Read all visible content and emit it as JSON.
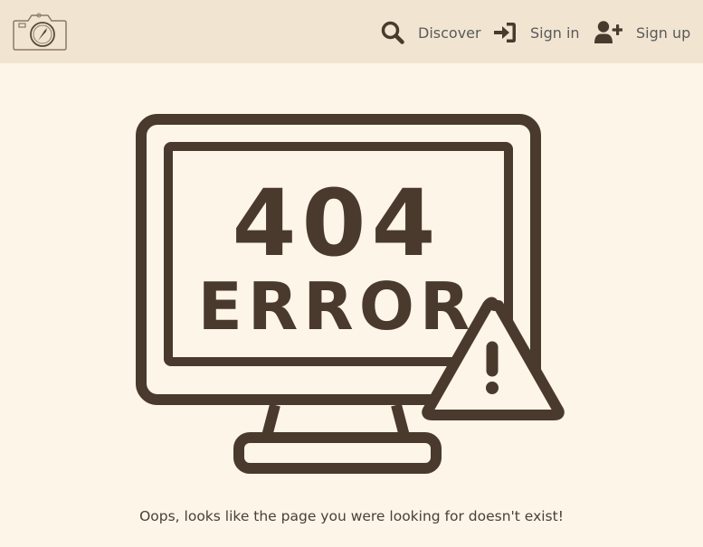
{
  "nav": {
    "logo_icon": "camera-compass-logo-icon",
    "discover": {
      "label": "Discover",
      "icon": "search-icon"
    },
    "signin": {
      "label": "Sign in",
      "icon": "sign-in-icon"
    },
    "signup": {
      "label": "Sign up",
      "icon": "user-plus-icon"
    }
  },
  "illustration": {
    "code": "404",
    "word": "ERROR",
    "icon": "warning-triangle-icon"
  },
  "message": "Oops, looks like the page you were looking for doesn't exist!",
  "colors": {
    "page_bg": "#fdf5e8",
    "navbar_bg": "#f1e5d2",
    "ink": "#4a3a2d"
  }
}
